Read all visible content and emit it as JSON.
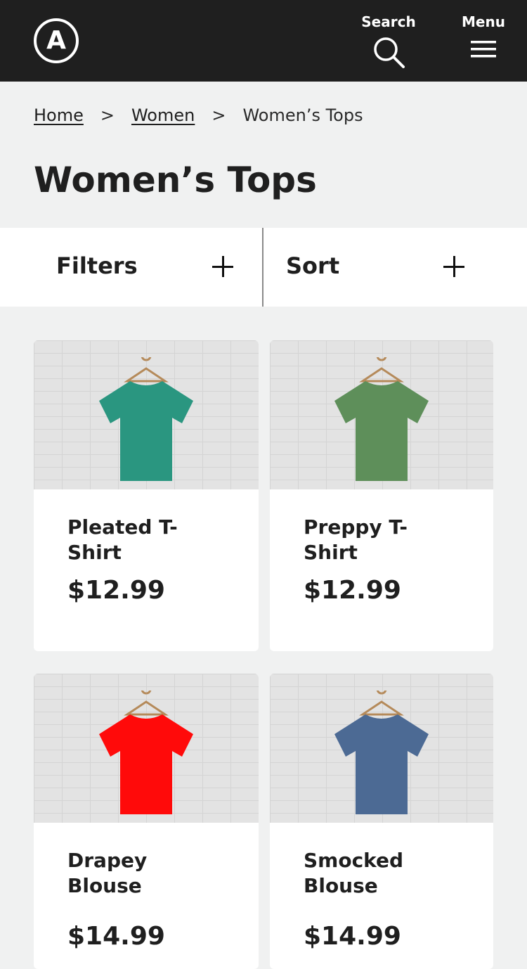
{
  "header": {
    "logo_letter": "A",
    "search_label": "Search",
    "menu_label": "Menu"
  },
  "breadcrumb": {
    "items": [
      "Home",
      "Women"
    ],
    "current": "Women’s Tops",
    "separator": ">"
  },
  "page": {
    "title": "Women’s Tops"
  },
  "toolbar": {
    "filters_label": "Filters",
    "sort_label": "Sort"
  },
  "products": [
    {
      "name": "Pleated T-Shirt",
      "price": "$12.99",
      "shirt_color": "#2a9680"
    },
    {
      "name": "Preppy T-Shirt",
      "price": "$12.99",
      "shirt_color": "#5e8f5a"
    },
    {
      "name": "Drapey Blouse",
      "price": "$14.99",
      "shirt_color": "#ff0a0a"
    },
    {
      "name": "Smocked Blouse",
      "price": "$14.99",
      "shirt_color": "#4c6a94"
    }
  ]
}
